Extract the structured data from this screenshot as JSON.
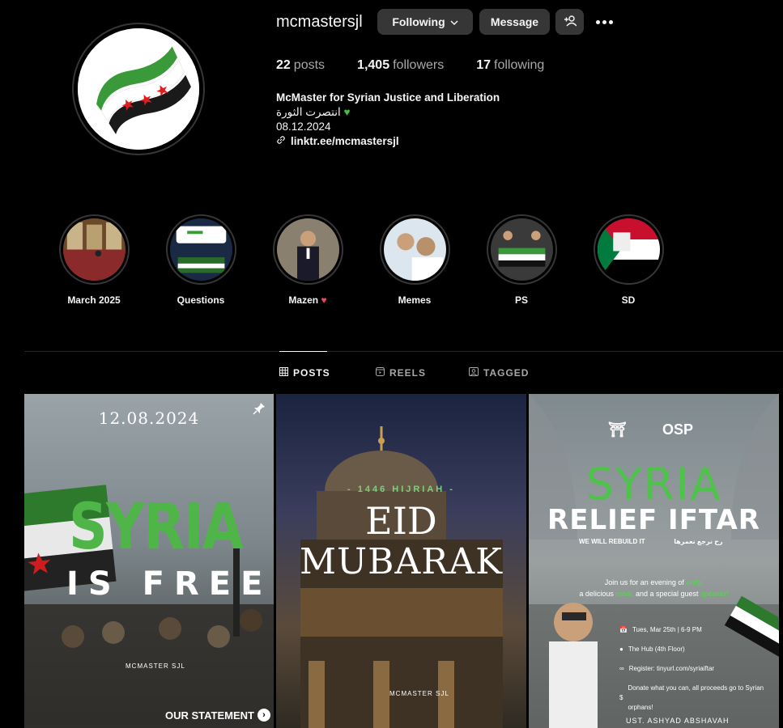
{
  "profile": {
    "username": "mcmastersjl",
    "following_label": "Following",
    "message_label": "Message",
    "stats": {
      "posts_count": "22",
      "posts_label": "posts",
      "followers_count": "1,405",
      "followers_label": "followers",
      "following_count": "17",
      "following_label": "following"
    },
    "bio": {
      "name": "McMaster for Syrian Justice and Liberation",
      "line1": "انتصرت الثورة",
      "line2": "08.12.2024",
      "link": "linktr.ee/mcmastersjl"
    }
  },
  "highlights": [
    {
      "label": "March 2025"
    },
    {
      "label": "Questions"
    },
    {
      "label": "Mazen"
    },
    {
      "label": "Memes"
    },
    {
      "label": "PS"
    },
    {
      "label": "SD"
    }
  ],
  "tabs": {
    "posts": "POSTS",
    "reels": "REELS",
    "tagged": "TAGGED"
  },
  "posts": {
    "p1": {
      "date": "12.08.2024",
      "headline": "SYRIA",
      "subheadline": "IS FREE",
      "watermark": "MCMASTER SJL",
      "cta": "OUR STATEMENT"
    },
    "p2": {
      "hijri": "- 1446 HIJRIAH -",
      "eid": "EID",
      "mubarak": "MUBARAK",
      "watermark": "MCMASTER SJL"
    },
    "p3": {
      "logo": "OSP",
      "headline": "SYRIA",
      "subheadline": "RELIEF IFTAR",
      "rebuild": "WE WILL REBUILD IT",
      "rebuild_ar": "رح نرجع نعمرها",
      "invite_1": "Join us for an evening of",
      "invite_1_g": "unity,",
      "invite_2": "a delicious",
      "invite_2_g": "meal,",
      "invite_3": "and a special guest",
      "invite_3_g": "speaker!",
      "date": "Tues, Mar 25th | 6-9 PM",
      "venue": "The Hub (4th Floor)",
      "register": "Register: tinyurl.com/syriaiftar",
      "donate": "Donate what you can, all proceeds go to Syrian orphans!",
      "footer": "UST. ASHYAD ABSHAVAH"
    }
  },
  "colors": {
    "background": "#000000",
    "button": "#363636",
    "muted": "#a8a8a8",
    "syria_green": "#4fb548",
    "heart_red": "#ed4956"
  }
}
